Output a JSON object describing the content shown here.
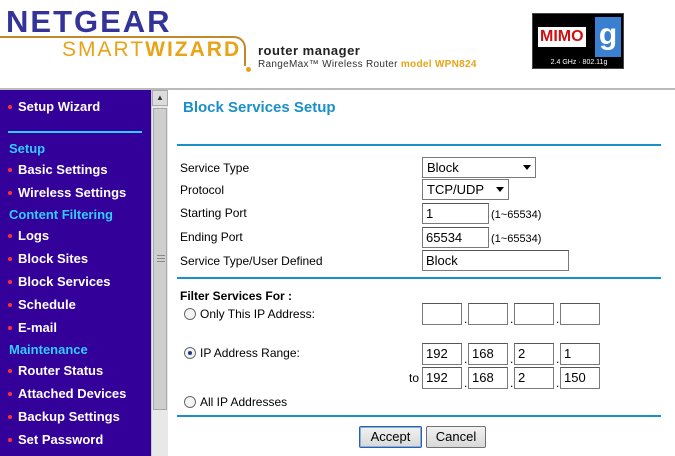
{
  "header": {
    "brand": "NETGEAR",
    "product_light": "SMART",
    "product_bold": "WIZARD",
    "title": "router manager",
    "subtitle": "RangeMax™ Wireless Router",
    "model_label": "model WPN824",
    "badge": {
      "text": "MIMO",
      "letter": "g",
      "caption": "2.4 GHz · 802.11g"
    }
  },
  "sidebar": {
    "top_item": "Setup Wizard",
    "sections": [
      {
        "title": "Setup",
        "items": [
          "Basic Settings",
          "Wireless Settings"
        ]
      },
      {
        "title": "Content Filtering",
        "items": [
          "Logs",
          "Block Sites",
          "Block Services",
          "Schedule",
          "E-mail"
        ]
      },
      {
        "title": "Maintenance",
        "items": [
          "Router Status",
          "Attached Devices",
          "Backup Settings",
          "Set Password"
        ]
      }
    ]
  },
  "main": {
    "title": "Block Services Setup",
    "fields": {
      "service_type": {
        "label": "Service Type",
        "value": "Block"
      },
      "protocol": {
        "label": "Protocol",
        "value": "TCP/UDP"
      },
      "starting_port": {
        "label": "Starting Port",
        "value": "1",
        "hint": "(1~65534)"
      },
      "ending_port": {
        "label": "Ending Port",
        "value": "65534",
        "hint": "(1~65534)"
      },
      "user_defined": {
        "label": "Service Type/User Defined",
        "value": "Block"
      }
    },
    "filter": {
      "heading": "Filter Services For :",
      "only_ip": {
        "label": "Only This IP Address:",
        "checked": false,
        "octets": [
          "",
          "",
          "",
          ""
        ]
      },
      "ip_range": {
        "label": "IP Address Range:",
        "checked": true,
        "from": [
          "192",
          "168",
          "2",
          "1"
        ],
        "to_label": "to",
        "to": [
          "192",
          "168",
          "2",
          "150"
        ]
      },
      "all_ip": {
        "label": "All IP Addresses",
        "checked": false
      }
    },
    "buttons": {
      "accept": "Accept",
      "cancel": "Cancel"
    }
  },
  "colors": {
    "sidebar_bg": "#330099",
    "section_title": "#33ccff",
    "page_title": "#1a8fc8",
    "bullet": "#ff3333",
    "brand": "#333399",
    "wizard": "#e8a317"
  }
}
